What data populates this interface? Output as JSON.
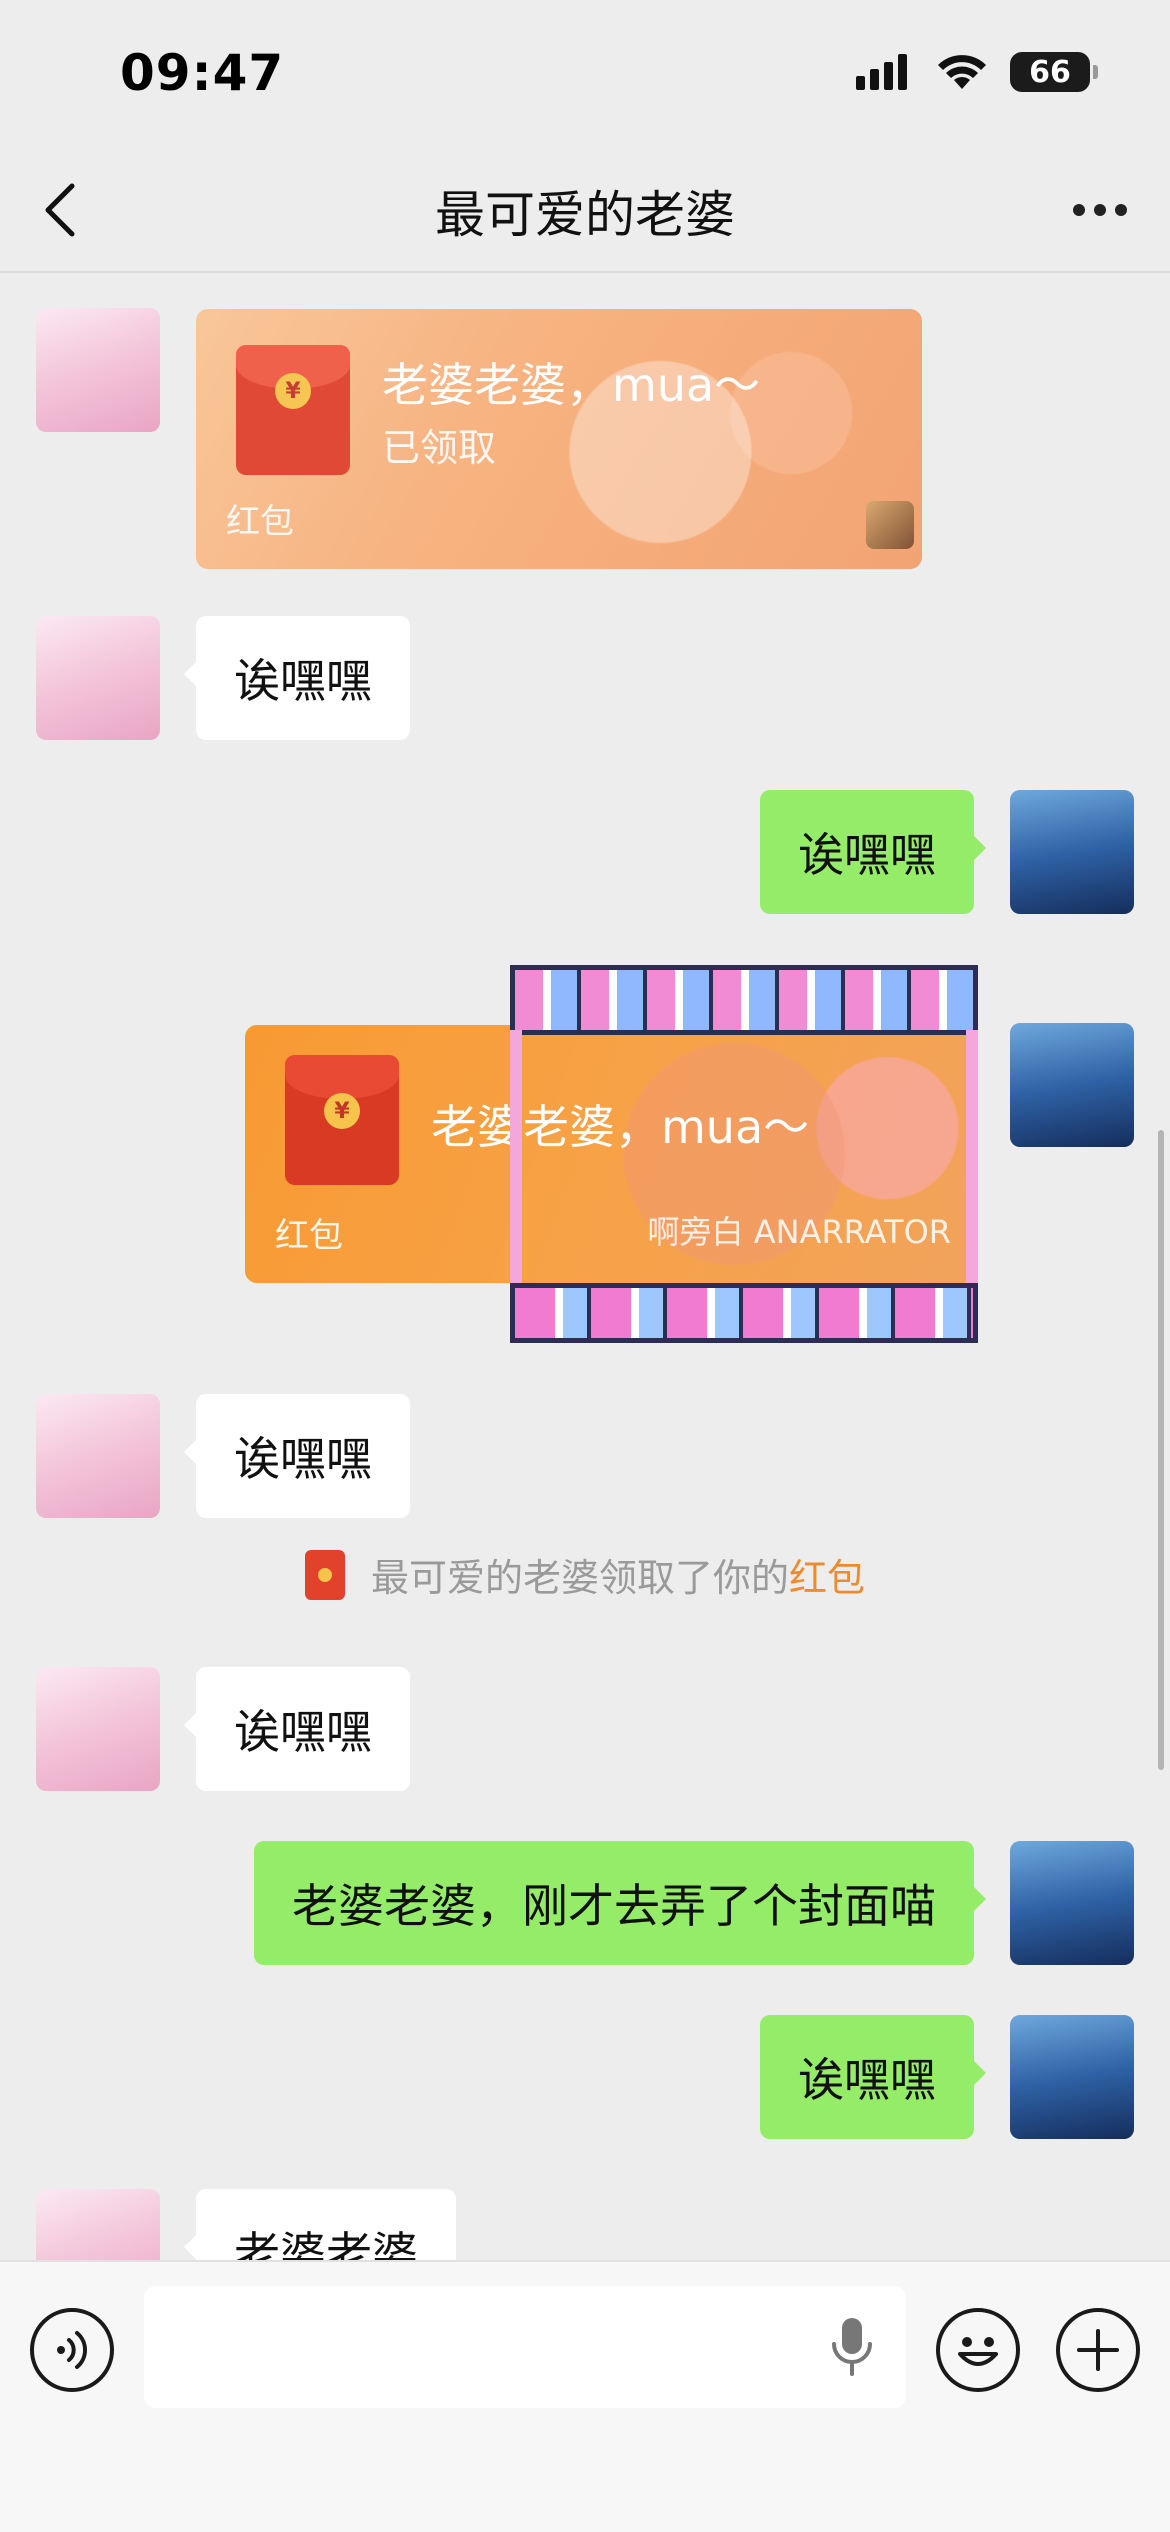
{
  "status_bar": {
    "time": "09:47",
    "battery": "66",
    "icons": [
      "signal-icon",
      "wifi-icon",
      "battery-icon"
    ]
  },
  "nav": {
    "title": "最可爱的老婆",
    "back_icon": "chevron-left-icon",
    "more_icon": "more-icon"
  },
  "messages": [
    {
      "side": "left",
      "type": "red_packet",
      "title": "老婆老婆，mua～",
      "status": "已领取",
      "label": "红包"
    },
    {
      "side": "left",
      "type": "text",
      "text": "诶嘿嘿"
    },
    {
      "side": "right",
      "type": "text",
      "text": "诶嘿嘿"
    },
    {
      "side": "right",
      "type": "red_packet",
      "title": "老婆老婆，mua～",
      "label": "红包",
      "sponsor": "啊旁白 ANARRATOR"
    },
    {
      "side": "left",
      "type": "text",
      "text": "诶嘿嘿"
    },
    {
      "type": "system",
      "text": "最可爱的老婆领取了你的",
      "link": "红包"
    },
    {
      "side": "left",
      "type": "text",
      "text": "诶嘿嘿"
    },
    {
      "side": "right",
      "type": "text",
      "text": "老婆老婆，刚才去弄了个封面喵"
    },
    {
      "side": "right",
      "type": "text",
      "text": "诶嘿嘿"
    },
    {
      "side": "left",
      "type": "text",
      "text": "老婆老婆"
    }
  ],
  "input_bar": {
    "voice_icon": "voice-icon",
    "mic_icon": "mic-icon",
    "emoji_icon": "emoji-icon",
    "plus_icon": "plus-icon"
  },
  "colors": {
    "background": "#ededed",
    "green_bubble": "#95ec69",
    "white_bubble": "#ffffff",
    "link_orange": "#f08a2b",
    "packet_orange": "#f89a33"
  }
}
